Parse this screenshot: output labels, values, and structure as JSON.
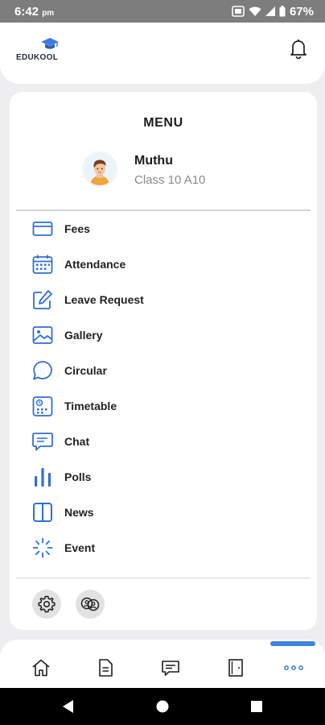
{
  "status_bar": {
    "time": "6:42",
    "ampm": "pm",
    "battery": "67%"
  },
  "header": {
    "logo_text": "EDUKOOL"
  },
  "menu": {
    "title": "MENU",
    "profile": {
      "name": "Muthu",
      "class": "Class 10 A10"
    },
    "items": [
      {
        "label": "Fees",
        "icon": "credit-card-icon"
      },
      {
        "label": "Attendance",
        "icon": "calendar-icon"
      },
      {
        "label": "Leave Request",
        "icon": "edit-icon"
      },
      {
        "label": "Gallery",
        "icon": "image-icon"
      },
      {
        "label": "Circular",
        "icon": "message-circle-icon"
      },
      {
        "label": "Timetable",
        "icon": "timetable-icon"
      },
      {
        "label": "Chat",
        "icon": "chat-icon"
      },
      {
        "label": "Polls",
        "icon": "bar-chart-icon"
      },
      {
        "label": "News",
        "icon": "columns-icon"
      },
      {
        "label": "Event",
        "icon": "loader-icon"
      }
    ],
    "quick_actions": [
      {
        "icon": "settings-icon"
      },
      {
        "icon": "switch-account-icon"
      }
    ]
  },
  "bottom_nav": {
    "items": [
      {
        "icon": "home-icon"
      },
      {
        "icon": "document-icon"
      },
      {
        "icon": "message-icon"
      },
      {
        "icon": "door-icon"
      },
      {
        "icon": "more-icon"
      }
    ],
    "active_index": 4
  },
  "colors": {
    "accent": "#2f6fd8",
    "status_bar": "#7d7d7d",
    "background": "#eeeef0"
  }
}
